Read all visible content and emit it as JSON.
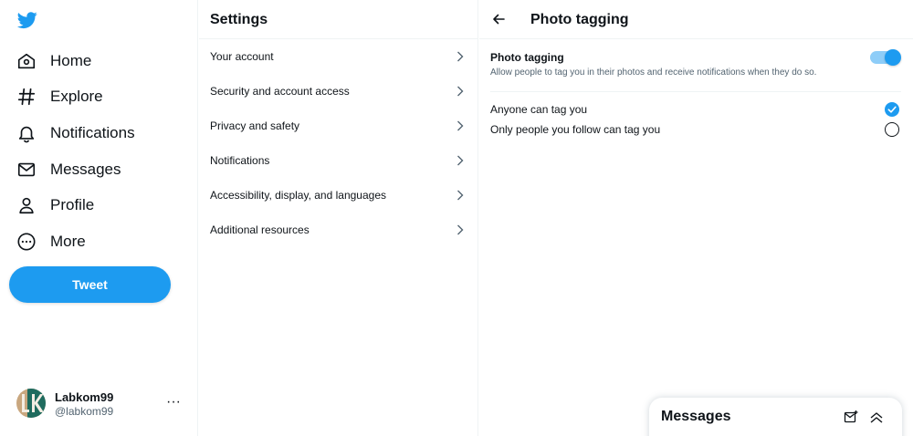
{
  "nav": {
    "items": [
      {
        "label": "Home",
        "icon": "home-icon"
      },
      {
        "label": "Explore",
        "icon": "hashtag-icon"
      },
      {
        "label": "Notifications",
        "icon": "bell-icon"
      },
      {
        "label": "Messages",
        "icon": "envelope-icon"
      },
      {
        "label": "Profile",
        "icon": "person-icon"
      },
      {
        "label": "More",
        "icon": "more-circle-icon"
      }
    ],
    "tweet_label": "Tweet"
  },
  "account": {
    "name": "Labkom99",
    "handle": "@labkom99",
    "more": "···"
  },
  "settings": {
    "title": "Settings",
    "items": [
      {
        "label": "Your account"
      },
      {
        "label": "Security and account access"
      },
      {
        "label": "Privacy and safety"
      },
      {
        "label": "Notifications"
      },
      {
        "label": "Accessibility, display, and languages"
      },
      {
        "label": "Additional resources"
      }
    ]
  },
  "detail": {
    "title": "Photo tagging",
    "setting_title": "Photo tagging",
    "setting_description": "Allow people to tag you in their photos and receive notifications when they do so.",
    "toggle_on": true,
    "options": [
      {
        "label": "Anyone can tag you",
        "selected": true
      },
      {
        "label": "Only people you follow can tag you",
        "selected": false
      }
    ]
  },
  "messages_drawer": {
    "title": "Messages"
  },
  "colors": {
    "accent": "#1d9bf0",
    "text": "#0f1419",
    "muted": "#536471",
    "border": "#eff3f4"
  }
}
